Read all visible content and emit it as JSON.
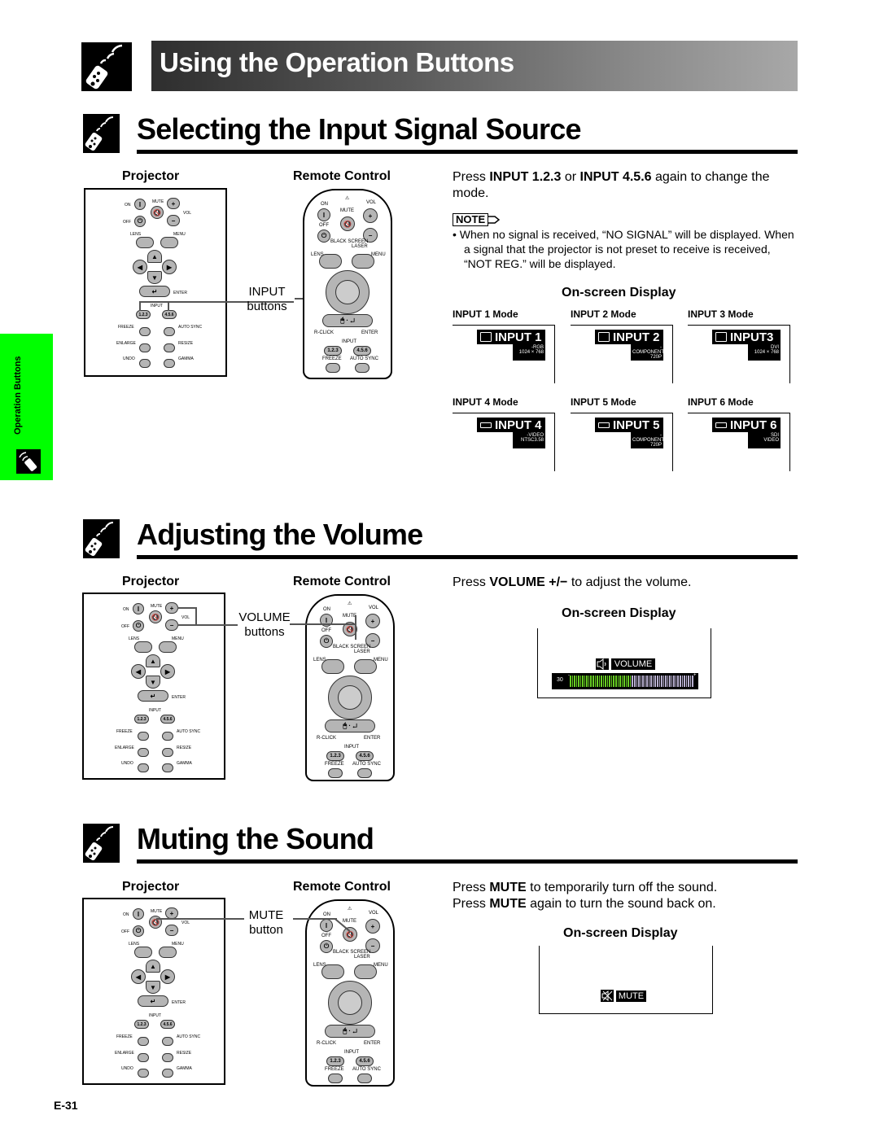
{
  "page_title": "Using the Operation Buttons",
  "side_tab": {
    "label": "Operation Buttons",
    "color": "#00ff00"
  },
  "page_number": "E-31",
  "common": {
    "projector_label": "Projector",
    "remote_label": "Remote Control",
    "osd_label": "On-screen Display"
  },
  "projector_panel": {
    "on": "ON",
    "off": "OFF",
    "mute": "MUTE",
    "vol": "VOL",
    "lens": "LENS",
    "menu": "MENU",
    "enter": "ENTER",
    "input": "INPUT",
    "input_a": "1.2.3",
    "input_b": "4.5.6",
    "freeze": "FREEZE",
    "auto_sync": "AUTO SYNC",
    "enlarge": "ENLARGE",
    "resize": "RESIZE",
    "undo": "UNDO",
    "gamma": "GAMMA",
    "plus": "+",
    "minus": "−"
  },
  "remote_panel": {
    "on": "ON",
    "off": "OFF",
    "mute": "MUTE",
    "vol": "VOL",
    "black_screen": "BLACK SCREEN",
    "laser": "LASER",
    "lens": "LENS",
    "menu": "MENU",
    "r_click": "R-CLICK",
    "enter": "ENTER",
    "input": "INPUT",
    "input_a": "1.2.3",
    "input_b": "4.5.6",
    "freeze": "FREEZE",
    "auto_sync": "AUTO SYNC",
    "plus": "+",
    "minus": "−"
  },
  "sections": {
    "input": {
      "title": "Selecting the Input Signal Source",
      "callout_line1": "INPUT",
      "callout_line2": "buttons",
      "instruction_pre": "Press ",
      "instruction_b1": "INPUT 1.2.3",
      "instruction_mid": " or ",
      "instruction_b2": "INPUT 4.5.6",
      "instruction_post": " again to change the mode.",
      "note_label": "NOTE",
      "note_text": "When no signal is received, “NO SIGNAL” will be displayed. When a signal that the projector is not preset to receive is received, “NOT REG.” will be displayed.",
      "modes": [
        {
          "label": "INPUT 1 Mode",
          "osd_title": "INPUT 1",
          "line1": "-RGB",
          "line2": "1024 × 768",
          "icon": "monitor-icon"
        },
        {
          "label": "INPUT 2 Mode",
          "osd_title": "INPUT 2",
          "line1": "-COMPONENT",
          "line2": "720P",
          "icon": "monitor-icon"
        },
        {
          "label": "INPUT 3 Mode",
          "osd_title": "INPUT3",
          "line1": "DVI",
          "line2": "1024 × 768",
          "icon": "monitor-icon"
        },
        {
          "label": "INPUT 4 Mode",
          "osd_title": "INPUT 4",
          "line1": "-VIDEO",
          "line2": "NTSC3.58",
          "icon": "video-icon"
        },
        {
          "label": "INPUT 5 Mode",
          "osd_title": "INPUT 5",
          "line1": "-COMPONENT",
          "line2": "720P",
          "icon": "video-icon"
        },
        {
          "label": "INPUT 6 Mode",
          "osd_title": "INPUT 6",
          "line1": "SDI",
          "line2": "VIDEO",
          "icon": "video-icon"
        }
      ]
    },
    "volume": {
      "title": "Adjusting the Volume",
      "callout_line1": "VOLUME",
      "callout_line2": "buttons",
      "instruction_pre": "Press ",
      "instruction_b1": "VOLUME",
      "instruction_sym": " +/− ",
      "instruction_post": " to adjust the volume.",
      "osd_title": "VOLUME",
      "osd_value": "30",
      "osd_level_fraction": 0.5,
      "bar_active_color": "#66cc22",
      "bar_inactive_color": "#b8b0d0",
      "min_mark": "-",
      "max_mark": "+"
    },
    "mute": {
      "title": "Muting the Sound",
      "callout_line1": "MUTE",
      "callout_line2": "button",
      "line1_pre": "Press ",
      "line1_b": "MUTE",
      "line1_post": " to temporarily turn off the sound.",
      "line2_pre": "Press ",
      "line2_b": "MUTE",
      "line2_post": " again to turn the sound back on.",
      "osd_title": "MUTE"
    }
  }
}
